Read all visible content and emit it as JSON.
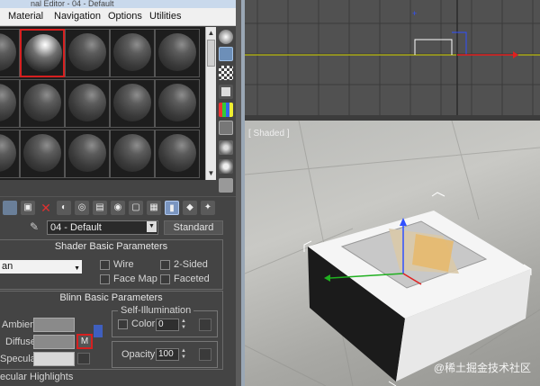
{
  "window": {
    "title": "nal Editor - 04 - Default"
  },
  "menubar": [
    "Material",
    "Navigation",
    "Options",
    "Utilities"
  ],
  "material_slots": {
    "rows": 3,
    "cols": 5,
    "selected_row": 0,
    "selected_col": 1
  },
  "material_name": {
    "value": "04 - Default",
    "type_button": "Standard"
  },
  "shader_basic": {
    "title": "Shader Basic Parameters",
    "shader_value": "an",
    "wire": "Wire",
    "two_sided": "2-Sided",
    "face_map": "Face Map",
    "faceted": "Faceted"
  },
  "blinn_basic": {
    "title": "Blinn Basic Parameters",
    "ambient": "Ambient:",
    "diffuse": "Diffuse:",
    "specular": "Specular:",
    "diffuse_map_button": "M",
    "self_illum_group": "Self-Illumination",
    "color_label": "Color",
    "color_value": "0",
    "opacity_label": "Opacity:",
    "opacity_value": "100"
  },
  "specular_highlights": "ecular Highlights",
  "viewport": {
    "label": "[ Shaded ]"
  },
  "watermark": "@稀土掘金技术社区",
  "colors": {
    "selection_red": "#d62020",
    "grid": "#3b3b3b",
    "axis_yellow": "#d8d800"
  }
}
